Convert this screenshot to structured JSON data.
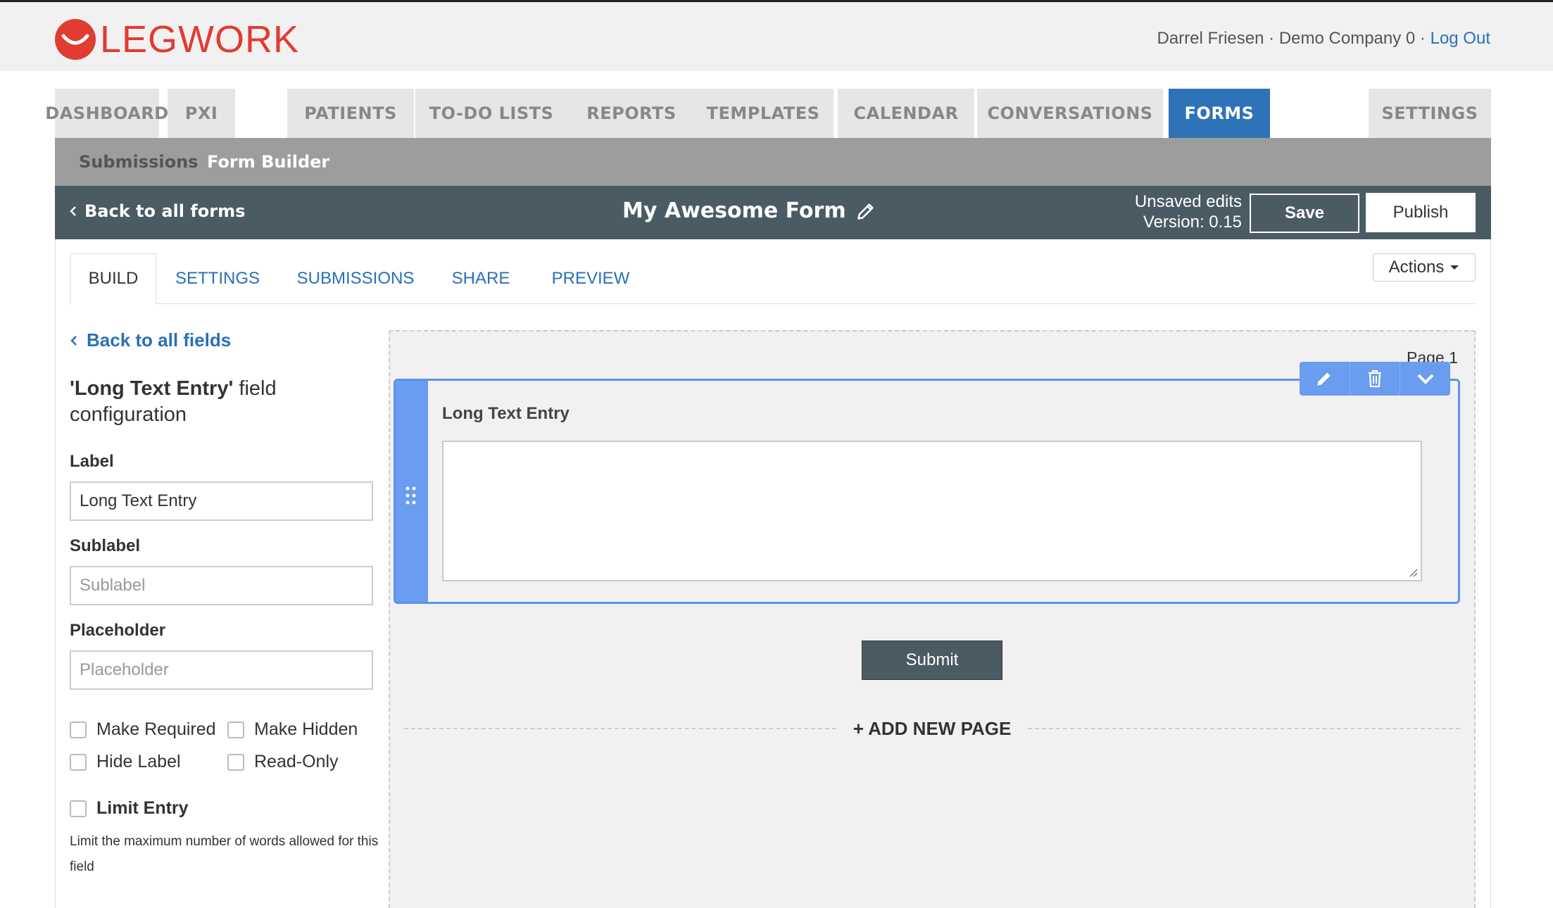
{
  "brand": {
    "logo_text": "LEGWORK",
    "color": "#e03c31"
  },
  "user": {
    "name": "Darrel Friesen",
    "company": "Demo Company 0",
    "logout_label": "Log Out",
    "separator": "·"
  },
  "nav": {
    "tabs": [
      "DASHBOARD",
      "PXI",
      "PATIENTS",
      "TO-DO LISTS",
      "REPORTS",
      "TEMPLATES",
      "CALENDAR",
      "CONVERSATIONS",
      "FORMS",
      "SETTINGS"
    ],
    "active": "FORMS"
  },
  "subnav": {
    "submissions": "Submissions",
    "form_builder": "Form Builder"
  },
  "form_header": {
    "back_label": "Back to all forms",
    "title": "My Awesome Form",
    "status_line1": "Unsaved edits",
    "status_line2": "Version: 0.15",
    "save_label": "Save",
    "publish_label": "Publish"
  },
  "tabs": {
    "items": [
      "BUILD",
      "SETTINGS",
      "SUBMISSIONS",
      "SHARE",
      "PREVIEW"
    ],
    "active": "BUILD",
    "actions_label": "Actions"
  },
  "field_config": {
    "back_label": "Back to all fields",
    "title_field": "'Long Text Entry'",
    "title_rest": " field configuration",
    "label_heading": "Label",
    "label_value": "Long Text Entry",
    "sublabel_heading": "Sublabel",
    "sublabel_placeholder": "Sublabel",
    "placeholder_heading": "Placeholder",
    "placeholder_placeholder": "Placeholder",
    "checkboxes": {
      "make_required": "Make Required",
      "make_hidden": "Make Hidden",
      "hide_label": "Hide Label",
      "read_only": "Read-Only",
      "limit_entry": "Limit Entry"
    },
    "limit_help": "Limit the maximum number of words allowed for this field"
  },
  "canvas": {
    "page_label": "Page 1",
    "field_label": "Long Text Entry",
    "submit_label": "Submit",
    "add_page_label": "+ ADD NEW PAGE"
  },
  "colors": {
    "accent": "#2e73b8",
    "dark_bar": "#4b5b63",
    "field_blue": "#6a9cf0"
  }
}
